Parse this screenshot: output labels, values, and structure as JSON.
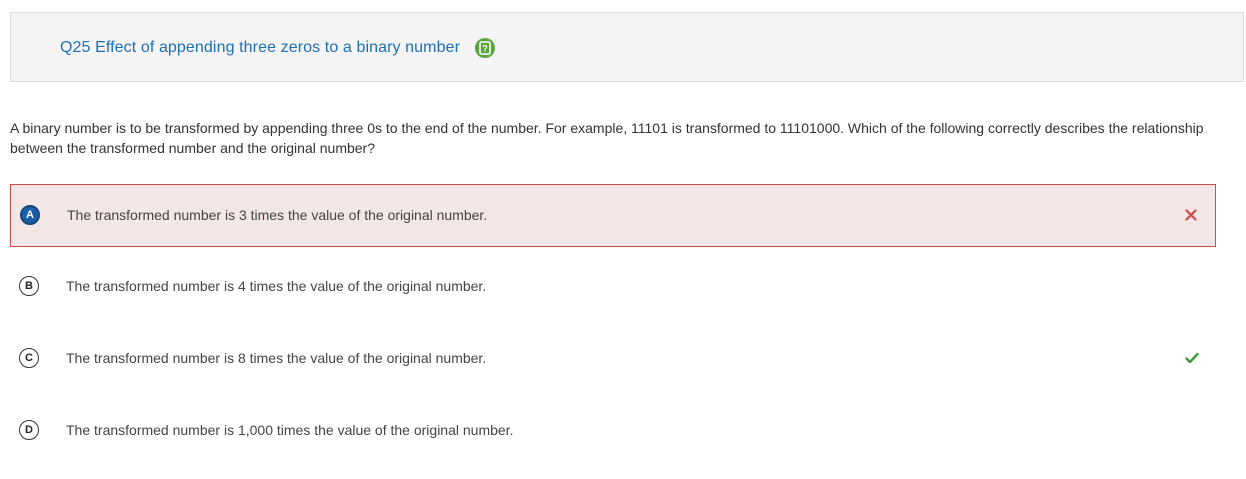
{
  "header": {
    "title": "Q25 Effect of appending three zeros to a binary number",
    "help_icon": "help-question-icon"
  },
  "question": {
    "text": "A binary number is to be transformed by appending three 0s to the end of the number. For example, 11101 is transformed to 11101000. Which of the following correctly describes the relationship between the transformed number and the original number?"
  },
  "options": [
    {
      "letter": "A",
      "text": "The transformed number is 3 times the value of the original number.",
      "state": "selected-incorrect",
      "mark_icon": "x-icon"
    },
    {
      "letter": "B",
      "text": "The transformed number is 4 times the value of the original number.",
      "state": "unselected"
    },
    {
      "letter": "C",
      "text": "The transformed number is 8 times the value of the original number.",
      "state": "correct-answer",
      "mark_icon": "check-icon"
    },
    {
      "letter": "D",
      "text": "The transformed number is 1,000 times the value of the original number.",
      "state": "unselected"
    }
  ],
  "colors": {
    "title": "#1f6fb5",
    "help_icon": "#5aa63b",
    "incorrect": "#d04a4a",
    "incorrect_bg": "#f3e6e6",
    "correct": "#3d9b3d",
    "selected_letter": "#1a5fa8"
  }
}
